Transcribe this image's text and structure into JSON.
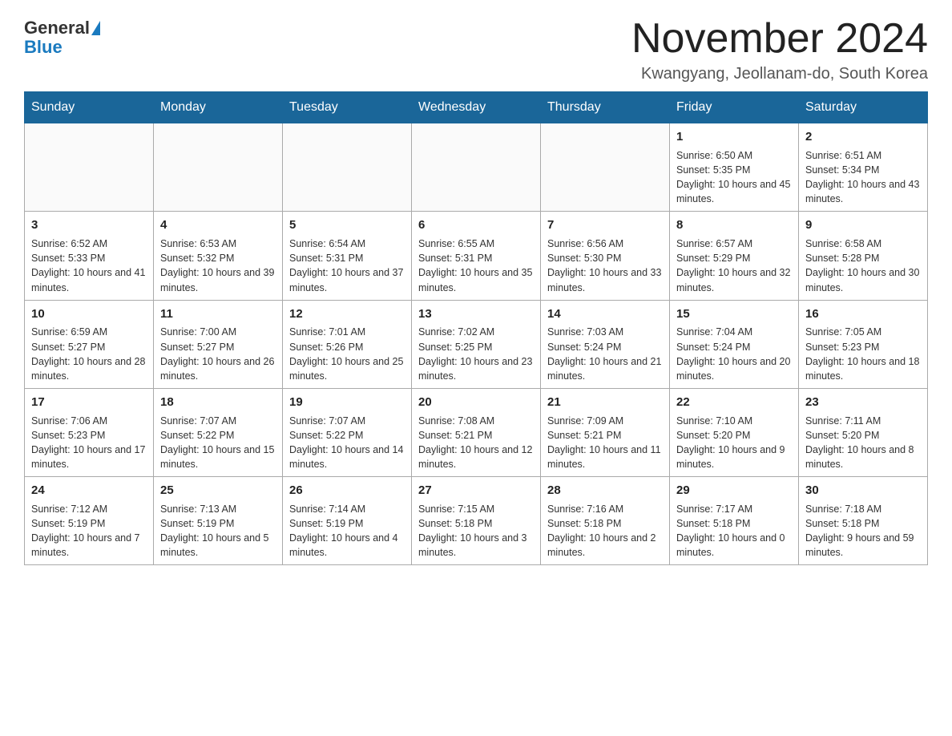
{
  "logo": {
    "general": "General",
    "blue": "Blue"
  },
  "title": "November 2024",
  "location": "Kwangyang, Jeollanam-do, South Korea",
  "days_of_week": [
    "Sunday",
    "Monday",
    "Tuesday",
    "Wednesday",
    "Thursday",
    "Friday",
    "Saturday"
  ],
  "weeks": [
    [
      {
        "day": "",
        "info": ""
      },
      {
        "day": "",
        "info": ""
      },
      {
        "day": "",
        "info": ""
      },
      {
        "day": "",
        "info": ""
      },
      {
        "day": "",
        "info": ""
      },
      {
        "day": "1",
        "info": "Sunrise: 6:50 AM\nSunset: 5:35 PM\nDaylight: 10 hours and 45 minutes."
      },
      {
        "day": "2",
        "info": "Sunrise: 6:51 AM\nSunset: 5:34 PM\nDaylight: 10 hours and 43 minutes."
      }
    ],
    [
      {
        "day": "3",
        "info": "Sunrise: 6:52 AM\nSunset: 5:33 PM\nDaylight: 10 hours and 41 minutes."
      },
      {
        "day": "4",
        "info": "Sunrise: 6:53 AM\nSunset: 5:32 PM\nDaylight: 10 hours and 39 minutes."
      },
      {
        "day": "5",
        "info": "Sunrise: 6:54 AM\nSunset: 5:31 PM\nDaylight: 10 hours and 37 minutes."
      },
      {
        "day": "6",
        "info": "Sunrise: 6:55 AM\nSunset: 5:31 PM\nDaylight: 10 hours and 35 minutes."
      },
      {
        "day": "7",
        "info": "Sunrise: 6:56 AM\nSunset: 5:30 PM\nDaylight: 10 hours and 33 minutes."
      },
      {
        "day": "8",
        "info": "Sunrise: 6:57 AM\nSunset: 5:29 PM\nDaylight: 10 hours and 32 minutes."
      },
      {
        "day": "9",
        "info": "Sunrise: 6:58 AM\nSunset: 5:28 PM\nDaylight: 10 hours and 30 minutes."
      }
    ],
    [
      {
        "day": "10",
        "info": "Sunrise: 6:59 AM\nSunset: 5:27 PM\nDaylight: 10 hours and 28 minutes."
      },
      {
        "day": "11",
        "info": "Sunrise: 7:00 AM\nSunset: 5:27 PM\nDaylight: 10 hours and 26 minutes."
      },
      {
        "day": "12",
        "info": "Sunrise: 7:01 AM\nSunset: 5:26 PM\nDaylight: 10 hours and 25 minutes."
      },
      {
        "day": "13",
        "info": "Sunrise: 7:02 AM\nSunset: 5:25 PM\nDaylight: 10 hours and 23 minutes."
      },
      {
        "day": "14",
        "info": "Sunrise: 7:03 AM\nSunset: 5:24 PM\nDaylight: 10 hours and 21 minutes."
      },
      {
        "day": "15",
        "info": "Sunrise: 7:04 AM\nSunset: 5:24 PM\nDaylight: 10 hours and 20 minutes."
      },
      {
        "day": "16",
        "info": "Sunrise: 7:05 AM\nSunset: 5:23 PM\nDaylight: 10 hours and 18 minutes."
      }
    ],
    [
      {
        "day": "17",
        "info": "Sunrise: 7:06 AM\nSunset: 5:23 PM\nDaylight: 10 hours and 17 minutes."
      },
      {
        "day": "18",
        "info": "Sunrise: 7:07 AM\nSunset: 5:22 PM\nDaylight: 10 hours and 15 minutes."
      },
      {
        "day": "19",
        "info": "Sunrise: 7:07 AM\nSunset: 5:22 PM\nDaylight: 10 hours and 14 minutes."
      },
      {
        "day": "20",
        "info": "Sunrise: 7:08 AM\nSunset: 5:21 PM\nDaylight: 10 hours and 12 minutes."
      },
      {
        "day": "21",
        "info": "Sunrise: 7:09 AM\nSunset: 5:21 PM\nDaylight: 10 hours and 11 minutes."
      },
      {
        "day": "22",
        "info": "Sunrise: 7:10 AM\nSunset: 5:20 PM\nDaylight: 10 hours and 9 minutes."
      },
      {
        "day": "23",
        "info": "Sunrise: 7:11 AM\nSunset: 5:20 PM\nDaylight: 10 hours and 8 minutes."
      }
    ],
    [
      {
        "day": "24",
        "info": "Sunrise: 7:12 AM\nSunset: 5:19 PM\nDaylight: 10 hours and 7 minutes."
      },
      {
        "day": "25",
        "info": "Sunrise: 7:13 AM\nSunset: 5:19 PM\nDaylight: 10 hours and 5 minutes."
      },
      {
        "day": "26",
        "info": "Sunrise: 7:14 AM\nSunset: 5:19 PM\nDaylight: 10 hours and 4 minutes."
      },
      {
        "day": "27",
        "info": "Sunrise: 7:15 AM\nSunset: 5:18 PM\nDaylight: 10 hours and 3 minutes."
      },
      {
        "day": "28",
        "info": "Sunrise: 7:16 AM\nSunset: 5:18 PM\nDaylight: 10 hours and 2 minutes."
      },
      {
        "day": "29",
        "info": "Sunrise: 7:17 AM\nSunset: 5:18 PM\nDaylight: 10 hours and 0 minutes."
      },
      {
        "day": "30",
        "info": "Sunrise: 7:18 AM\nSunset: 5:18 PM\nDaylight: 9 hours and 59 minutes."
      }
    ]
  ]
}
